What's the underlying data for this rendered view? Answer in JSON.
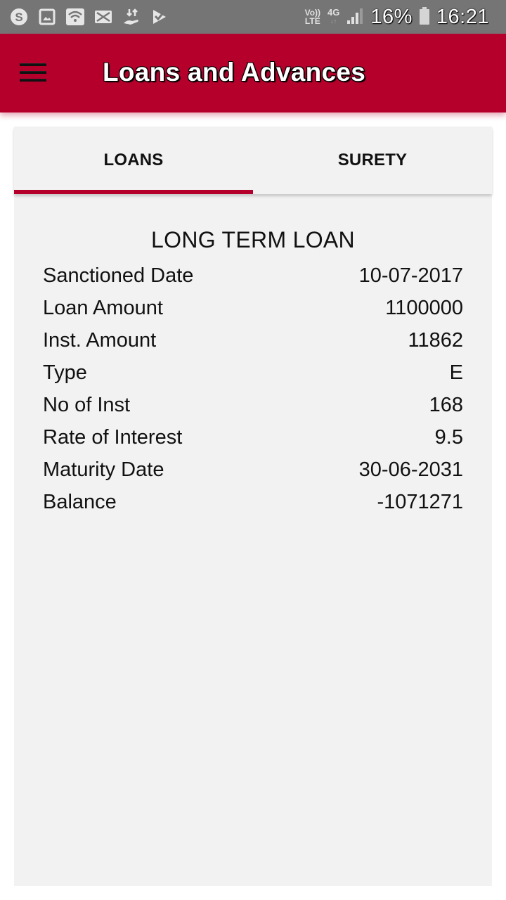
{
  "status_bar": {
    "left_icons": [
      "skype-icon",
      "gallery-icon",
      "wifi-icon",
      "mail-icon",
      "transfer-icon",
      "check-flag-icon"
    ],
    "volte_top": "Vo))",
    "volte_bottom": "LTE",
    "network": "4G",
    "battery_percent": "16%",
    "time": "16:21"
  },
  "app_bar": {
    "title": "Loans and Advances",
    "menu_icon": "hamburger-menu-icon"
  },
  "tabs": [
    {
      "label": "LOANS",
      "active": true
    },
    {
      "label": "SURETY",
      "active": false
    }
  ],
  "loan": {
    "title": "LONG TERM LOAN",
    "fields": [
      {
        "label": "Sanctioned Date",
        "value": "10-07-2017"
      },
      {
        "label": "Loan Amount",
        "value": "1100000"
      },
      {
        "label": "Inst. Amount",
        "value": "11862"
      },
      {
        "label": "Type",
        "value": "E"
      },
      {
        "label": "No of Inst",
        "value": "168"
      },
      {
        "label": "Rate of Interest",
        "value": "9.5"
      },
      {
        "label": "Maturity Date",
        "value": "30-06-2031"
      },
      {
        "label": "Balance",
        "value": "-1071271"
      }
    ]
  },
  "colors": {
    "accent": "#b5002c",
    "status_bar": "#757575",
    "card_bg": "#f2f2f2"
  }
}
